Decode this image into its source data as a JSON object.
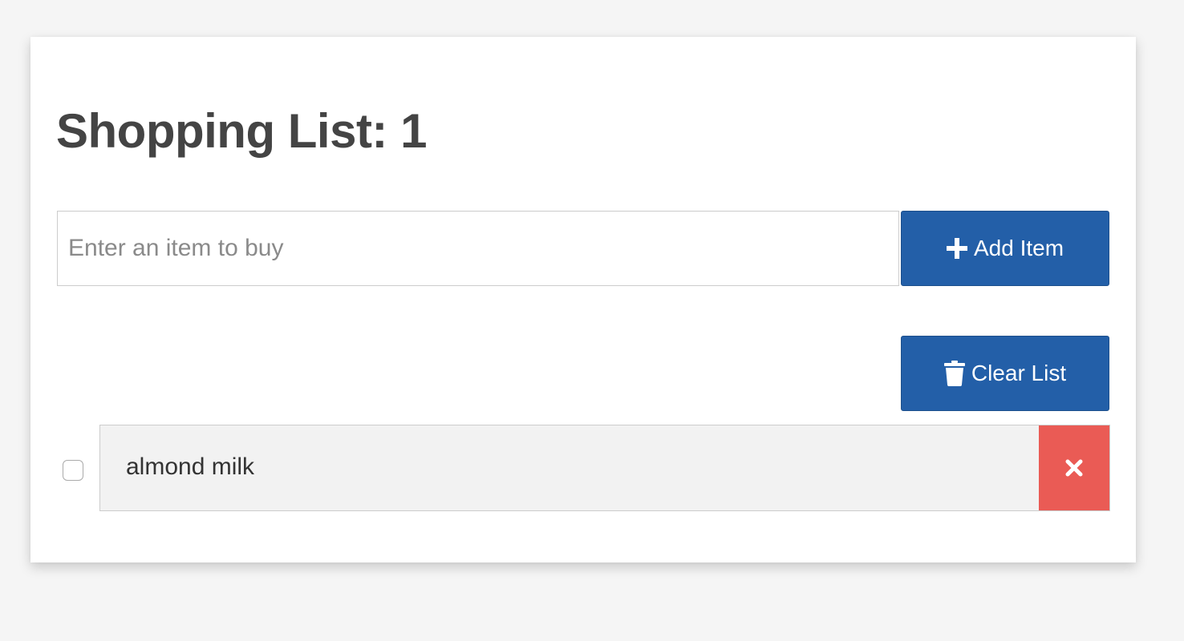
{
  "header": {
    "title": "Shopping List: 1"
  },
  "add_form": {
    "input_value": "",
    "input_placeholder": "Enter an item to buy",
    "add_button_label": "Add Item",
    "add_button_icon": "plus-icon"
  },
  "actions": {
    "clear_button_label": "Clear List",
    "clear_button_icon": "trash-icon"
  },
  "items": [
    {
      "label": "almond milk",
      "checked": false,
      "remove_icon": "close-icon"
    }
  ],
  "colors": {
    "primary": "#235fa8",
    "danger": "#ea5b55",
    "title": "#444444",
    "item_background": "#f2f2f2",
    "page_background": "#f5f5f5"
  }
}
